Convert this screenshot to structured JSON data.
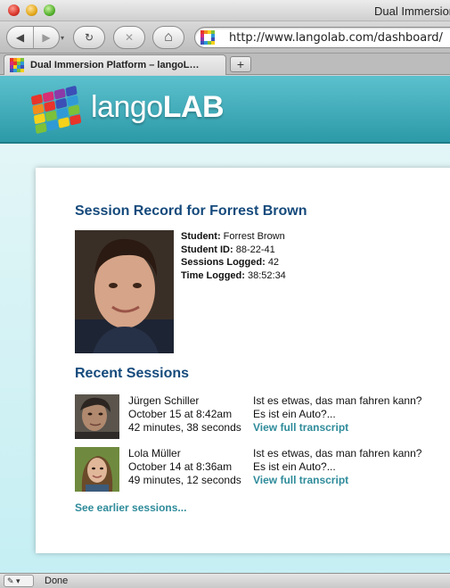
{
  "window": {
    "title": "Dual Immersion"
  },
  "toolbar": {
    "back_icon": "◀",
    "forward_icon": "▶",
    "history_icon": "▾",
    "reload_icon": "↻",
    "stop_icon": "✕",
    "home_icon": "⌂",
    "url": "http://www.langolab.com/dashboard/"
  },
  "tabs": {
    "active_label": "Dual Immersion Platform – langoL…",
    "new_tab_label": "+"
  },
  "site": {
    "logo_light": "lango",
    "logo_bold": "LAB",
    "logo_colors": [
      "#e8342a",
      "#f28c1c",
      "#f6d21a",
      "#7cc13a",
      "#2f9ad6",
      "#3b4fb7",
      "#8c3aa8",
      "#d82e74"
    ]
  },
  "session_record": {
    "heading": "Session Record for Forrest Brown",
    "student_label": "Student:",
    "student_value": "Forrest Brown",
    "id_label": "Student ID:",
    "id_value": "88-22-41",
    "sessions_label": "Sessions Logged:",
    "sessions_value": "42",
    "time_label": "Time Logged:",
    "time_value": "38:52:34"
  },
  "recent": {
    "heading": "Recent Sessions",
    "sessions": [
      {
        "name": "Jürgen Schiller",
        "date": "October 15 at 8:42am",
        "duration": "42 minutes, 38 seconds",
        "line1": "Ist es etwas, das man fahren kann?",
        "line2": "Es ist ein Auto?...",
        "link": "View full transcript"
      },
      {
        "name": "Lola Müller",
        "date": "October 14 at 8:36am",
        "duration": "49 minutes, 12 seconds",
        "line1": "Ist es etwas, das man fahren kann?",
        "line2": "Es ist ein Auto?...",
        "link": "View full transcript"
      }
    ],
    "earlier_link": "See earlier sessions..."
  },
  "status": {
    "text": "Done",
    "icon": "pen-icon"
  }
}
